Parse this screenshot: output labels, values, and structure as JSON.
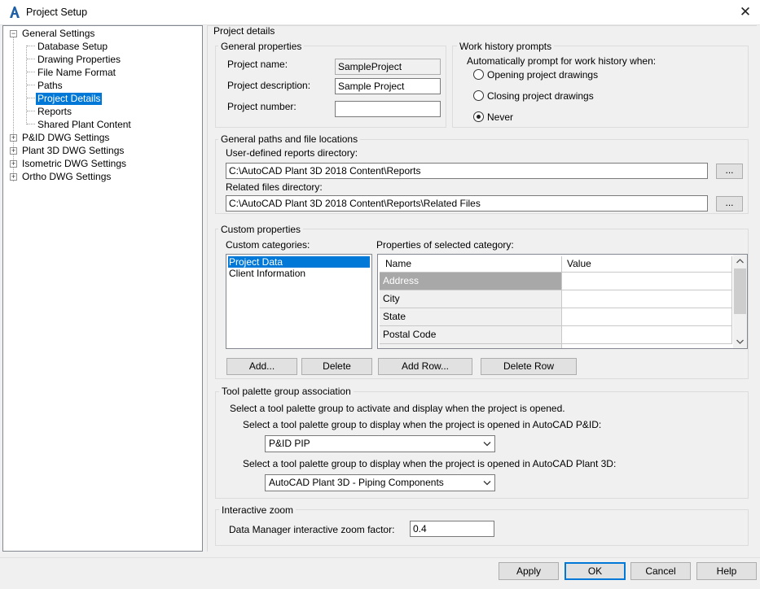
{
  "window": {
    "title": "Project Setup",
    "close_glyph": "✕",
    "icon": "autocad-a-icon"
  },
  "tree": {
    "general": {
      "label": "General Settings",
      "expander": "−"
    },
    "children": [
      {
        "label": "Database Setup"
      },
      {
        "label": "Drawing Properties"
      },
      {
        "label": "File Name Format"
      },
      {
        "label": "Paths"
      },
      {
        "label": "Project Details",
        "selected": true
      },
      {
        "label": "Reports"
      },
      {
        "label": "Shared Plant Content"
      }
    ],
    "others": [
      {
        "label": "P&ID DWG Settings",
        "expander": "+"
      },
      {
        "label": "Plant 3D DWG Settings",
        "expander": "+"
      },
      {
        "label": "Isometric DWG Settings",
        "expander": "+"
      },
      {
        "label": "Ortho DWG Settings",
        "expander": "+"
      }
    ]
  },
  "details": {
    "heading": "Project details",
    "general": {
      "title": "General properties",
      "name_label": "Project name:",
      "name_value": "SampleProject",
      "desc_label": "Project description:",
      "desc_value": "Sample Project",
      "number_label": "Project number:",
      "number_value": ""
    },
    "work_history": {
      "title": "Work history prompts",
      "prompt": "Automatically prompt for work history when:",
      "options": [
        {
          "label": "Opening project drawings",
          "checked": false
        },
        {
          "label": "Closing project drawings",
          "checked": false
        },
        {
          "label": "Never",
          "checked": true
        }
      ]
    },
    "paths": {
      "title": "General paths and file locations",
      "reports_label": "User-defined reports directory:",
      "reports_value": "C:\\AutoCAD Plant 3D 2018 Content\\Reports",
      "related_label": "Related files directory:",
      "related_value": "C:\\AutoCAD Plant 3D 2018 Content\\Reports\\Related Files",
      "browse_label": "..."
    },
    "custom": {
      "title": "Custom properties",
      "categories_label": "Custom categories:",
      "categories": [
        {
          "label": "Project Data",
          "selected": true
        },
        {
          "label": "Client Information",
          "selected": false
        }
      ],
      "props_label": "Properties of selected category:",
      "columns": [
        "Name",
        "Value"
      ],
      "rows": [
        {
          "name": "Address",
          "value": "",
          "selected": true
        },
        {
          "name": "City",
          "value": ""
        },
        {
          "name": "State",
          "value": ""
        },
        {
          "name": "Postal Code",
          "value": ""
        }
      ],
      "add_label": "Add...",
      "delete_label": "Delete",
      "add_row_label": "Add Row...",
      "delete_row_label": "Delete Row"
    },
    "palette": {
      "title": "Tool palette group association",
      "intro": "Select a tool palette group to activate and display when the project is opened.",
      "pid_label": "Select a tool palette group to display when the project is opened in AutoCAD P&ID:",
      "pid_value": "P&ID PIP",
      "plant_label": "Select a tool palette group to display when the project is opened in AutoCAD Plant 3D:",
      "plant_value": "AutoCAD Plant 3D - Piping Components"
    },
    "zoom": {
      "title": "Interactive zoom",
      "label": "Data Manager interactive zoom factor:",
      "value": "0.4"
    }
  },
  "footer": {
    "apply": "Apply",
    "ok": "OK",
    "cancel": "Cancel",
    "help": "Help"
  }
}
